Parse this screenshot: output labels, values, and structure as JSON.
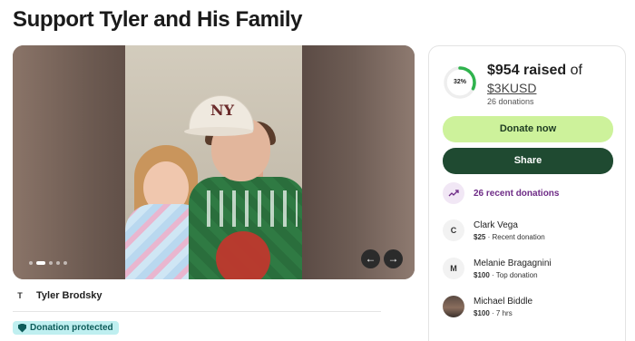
{
  "page": {
    "title": "Support Tyler and His Family"
  },
  "gallery": {
    "slide_count": 5,
    "active_slide": 2,
    "prev_label": "←",
    "next_label": "→"
  },
  "organizer": {
    "initial": "T",
    "name": "Tyler Brodsky"
  },
  "badge": {
    "label": "Donation protected"
  },
  "fundraiser": {
    "percent": 32,
    "percent_label": "32%",
    "raised": "$954 raised",
    "of_text": "of",
    "goal": "$3KUSD",
    "donation_count": "26 donations",
    "donate_label": "Donate now",
    "share_label": "Share",
    "recent_label": "26 recent donations",
    "accent_color": "#2fb34d",
    "donors": [
      {
        "initial": "C",
        "name": "Clark Vega",
        "amount": "$25",
        "sep": " · ",
        "detail": "Recent donation",
        "photo": false
      },
      {
        "initial": "M",
        "name": "Melanie Bragagnini",
        "amount": "$100",
        "sep": " · ",
        "detail": "Top donation",
        "photo": false
      },
      {
        "initial": "",
        "name": "Michael Biddle",
        "amount": "$100",
        "sep": " · ",
        "detail": "7 hrs",
        "photo": true
      }
    ]
  },
  "icons": [
    "left-arrow-icon",
    "right-arrow-icon",
    "shield-icon",
    "trend-up-icon",
    "progress-ring-icon"
  ]
}
